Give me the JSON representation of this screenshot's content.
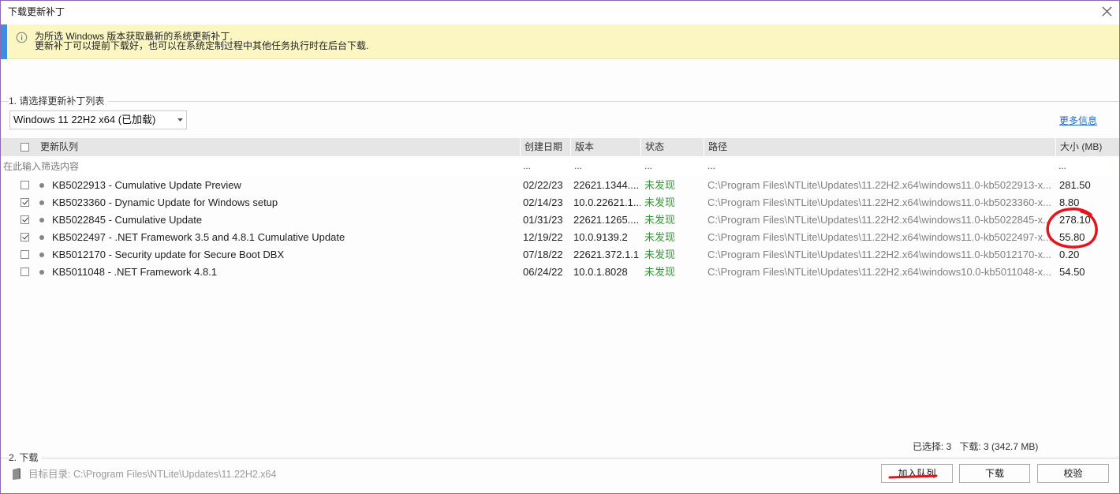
{
  "colors": {
    "window_border": "#8d66b9",
    "banner_bg": "#fcf7c2",
    "banner_accent": "#3f8ee0",
    "link_blue": "#1c6fd6",
    "status_green": "#2e9b2e",
    "path_gray": "#808080",
    "header_bg": "#e6e6e6",
    "annotation_red": "#e3141c"
  },
  "icons": {
    "close": "close-icon",
    "info": "info-icon",
    "dropdown": "chevron-down-icon",
    "row_status": "status-dot-icon",
    "target_dir": "drive-icon"
  },
  "window": {
    "title": "下载更新补丁"
  },
  "info_banner": {
    "line1": "为所选 Windows 版本获取最新的系统更新补丁.",
    "line2": "更新补丁可以提前下载好，也可以在系统定制过程中其他任务执行时在后台下载."
  },
  "section_select": {
    "title": "1. 请选择更新补丁列表",
    "dropdown_value": "Windows 11 22H2 x64 (已加载)",
    "more_info": "更多信息"
  },
  "table": {
    "select_all_checked": false,
    "columns": {
      "name": "更新队列",
      "date": "创建日期",
      "version": "版本",
      "status": "状态",
      "path": "路径",
      "size": "大小 (MB)"
    },
    "filter": {
      "placeholder": "在此输入筛选内容",
      "date": "...",
      "version": "...",
      "status": "...",
      "path": "...",
      "size": "..."
    },
    "rows": [
      {
        "checked": false,
        "name": "KB5022913 - Cumulative Update Preview",
        "date": "02/22/23",
        "version": "22621.1344....",
        "status": "未发现",
        "path": "C:\\Program Files\\NTLite\\Updates\\11.22H2.x64\\windows11.0-kb5022913-x...",
        "size": "281.50"
      },
      {
        "checked": true,
        "name": "KB5023360 - Dynamic Update for Windows setup",
        "date": "02/14/23",
        "version": "10.0.22621.1...",
        "status": "未发现",
        "path": "C:\\Program Files\\NTLite\\Updates\\11.22H2.x64\\windows11.0-kb5023360-x...",
        "size": "8.80"
      },
      {
        "checked": true,
        "name": "KB5022845 - Cumulative Update",
        "date": "01/31/23",
        "version": "22621.1265....",
        "status": "未发现",
        "path": "C:\\Program Files\\NTLite\\Updates\\11.22H2.x64\\windows11.0-kb5022845-x...",
        "size": "278.10"
      },
      {
        "checked": true,
        "name": "KB5022497 - .NET Framework 3.5 and 4.8.1 Cumulative Update",
        "date": "12/19/22",
        "version": "10.0.9139.2",
        "status": "未发现",
        "path": "C:\\Program Files\\NTLite\\Updates\\11.22H2.x64\\windows11.0-kb5022497-x...",
        "size": "55.80"
      },
      {
        "checked": false,
        "name": "KB5012170 - Security update for Secure Boot DBX",
        "date": "07/18/22",
        "version": "22621.372.1.1",
        "status": "未发现",
        "path": "C:\\Program Files\\NTLite\\Updates\\11.22H2.x64\\windows11.0-kb5012170-x...",
        "size": "0.20"
      },
      {
        "checked": false,
        "name": "KB5011048 - .NET Framework 4.8.1",
        "date": "06/24/22",
        "version": "10.0.1.8028",
        "status": "未发现",
        "path": "C:\\Program Files\\NTLite\\Updates\\11.22H2.x64\\windows10.0-kb5011048-x...",
        "size": "54.50"
      }
    ]
  },
  "summary": {
    "selected": "已选择: 3",
    "download": "下载: 3 (342.7 MB)"
  },
  "section_download": {
    "title": "2. 下载",
    "target_dir": "目标目录: C:\\Program Files\\NTLite\\Updates\\11.22H2.x64",
    "buttons": {
      "enqueue": "加入队列",
      "download": "下载",
      "verify": "校验"
    }
  }
}
